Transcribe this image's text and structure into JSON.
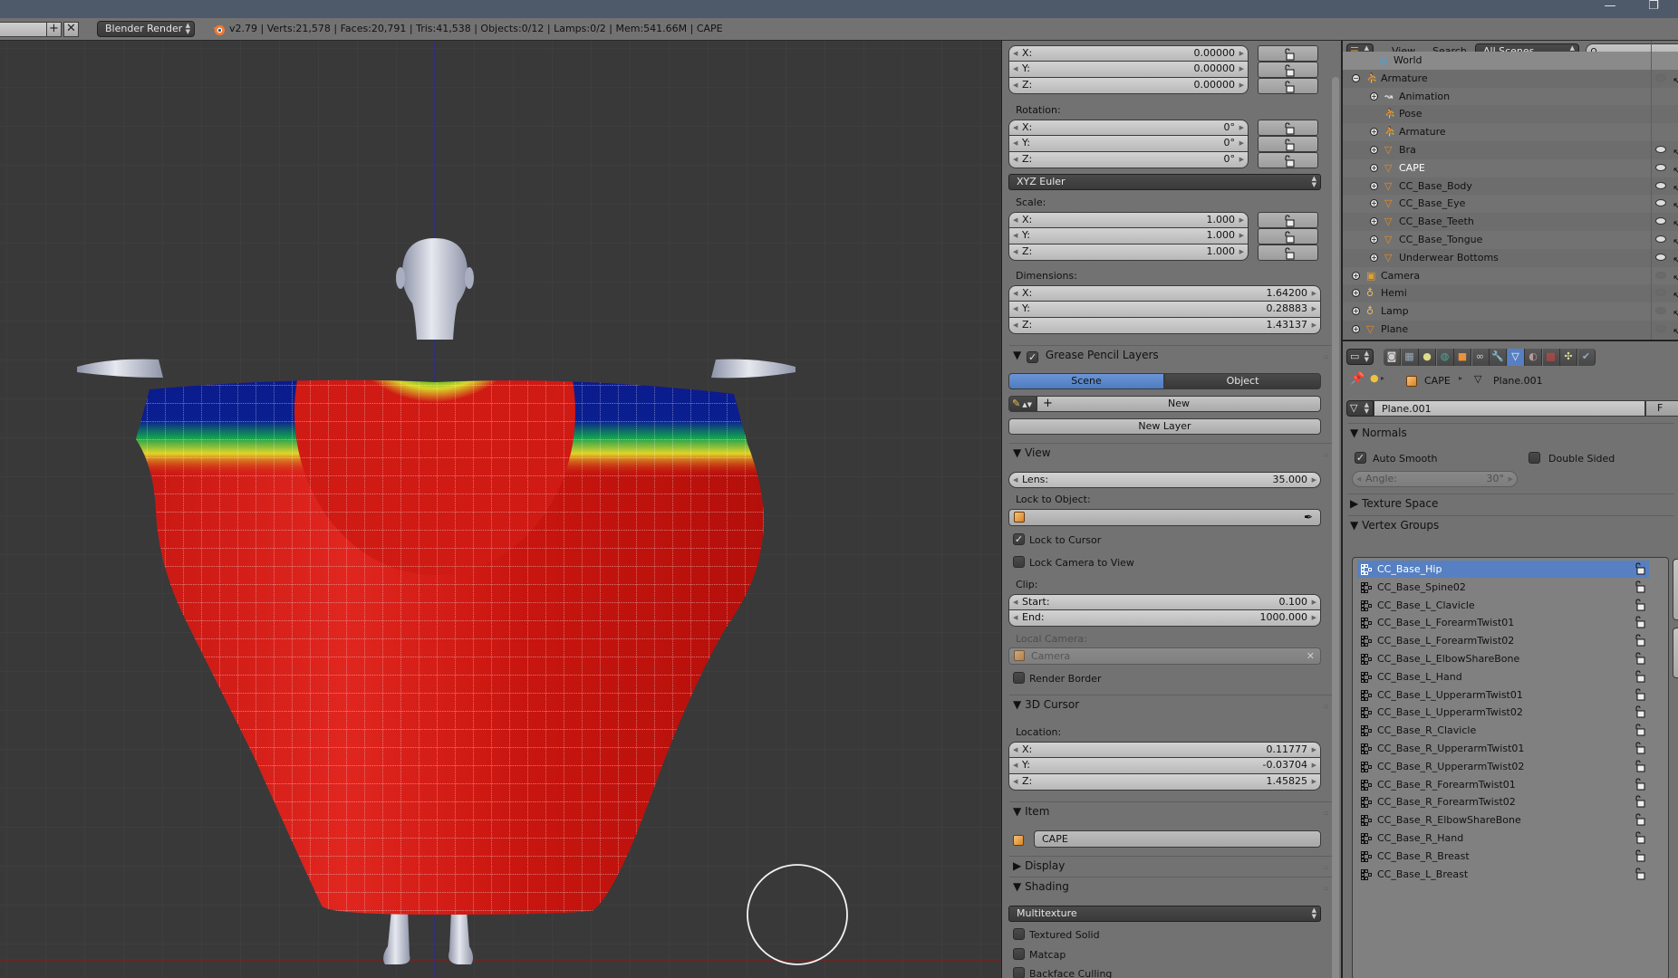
{
  "window": {
    "minimize_icon": "—",
    "restore_icon": "❐"
  },
  "info_bar": {
    "scene_field_value": "",
    "add_icon": "+",
    "remove_icon": "✕",
    "render_engine": "Blender Render",
    "stats": "v2.79 | Verts:21,578 | Faces:20,791 | Tris:41,538 | Objects:0/12 | Lamps:0/2 | Mem:541.66M | CAPE"
  },
  "npanel": {
    "location": {
      "x": {
        "k": "X:",
        "v": "0.00000"
      },
      "y": {
        "k": "Y:",
        "v": "0.00000"
      },
      "z": {
        "k": "Z:",
        "v": "0.00000"
      }
    },
    "rotation_label": "Rotation:",
    "rotation": {
      "x": {
        "k": "X:",
        "v": "0°"
      },
      "y": {
        "k": "Y:",
        "v": "0°"
      },
      "z": {
        "k": "Z:",
        "v": "0°"
      }
    },
    "rotation_mode": "XYZ Euler",
    "scale_label": "Scale:",
    "scale": {
      "x": {
        "k": "X:",
        "v": "1.000"
      },
      "y": {
        "k": "Y:",
        "v": "1.000"
      },
      "z": {
        "k": "Z:",
        "v": "1.000"
      }
    },
    "dimensions_label": "Dimensions:",
    "dimensions": {
      "x": {
        "k": "X:",
        "v": "1.64200"
      },
      "y": {
        "k": "Y:",
        "v": "0.28883"
      },
      "z": {
        "k": "Z:",
        "v": "1.43137"
      }
    },
    "grease_pencil": {
      "title": "Grease Pencil Layers",
      "enabled": true,
      "tab_scene": "Scene",
      "tab_object": "Object",
      "active_tab": "Scene",
      "new_label": "New",
      "new_layer_label": "New Layer"
    },
    "view": {
      "title": "View",
      "lens_label": "Lens:",
      "lens_value": "35.000",
      "lock_to_object_label": "Lock to Object:",
      "lock_to_object_value": "",
      "lock_to_cursor_label": "Lock to Cursor",
      "lock_to_cursor": true,
      "lock_camera_label": "Lock Camera to View",
      "lock_camera": false,
      "clip_label": "Clip:",
      "clip_start_label": "Start:",
      "clip_start": "0.100",
      "clip_end_label": "End:",
      "clip_end": "1000.000",
      "local_camera_label": "Local Camera:",
      "local_camera_value": "Camera",
      "render_border_label": "Render Border",
      "render_border": false
    },
    "cursor": {
      "title": "3D Cursor",
      "location_label": "Location:",
      "x": {
        "k": "X:",
        "v": "0.11777"
      },
      "y": {
        "k": "Y:",
        "v": "-0.03704"
      },
      "z": {
        "k": "Z:",
        "v": "1.45825"
      }
    },
    "item": {
      "title": "Item",
      "name": "CAPE"
    },
    "display": {
      "title": "Display"
    },
    "shading": {
      "title": "Shading",
      "mode": "Multitexture",
      "textured_solid_label": "Textured Solid",
      "matcap_label": "Matcap",
      "backface_label": "Backface Culling"
    }
  },
  "outliner": {
    "view_menu": "View",
    "search_menu": "Search",
    "display_mode": "All Scenes",
    "search_value": "",
    "rows": [
      {
        "name": "World",
        "type": "world",
        "visible": null
      },
      {
        "name": "Armature",
        "type": "armature",
        "visible": false
      },
      {
        "name": "Animation",
        "type": "animation",
        "visible": null
      },
      {
        "name": "Pose",
        "type": "pose",
        "visible": null
      },
      {
        "name": "Armature",
        "type": "armature-data",
        "visible": null
      },
      {
        "name": "Bra",
        "type": "mesh",
        "visible": true
      },
      {
        "name": "CAPE",
        "type": "mesh",
        "visible": true,
        "active": true
      },
      {
        "name": "CC_Base_Body",
        "type": "mesh",
        "visible": true
      },
      {
        "name": "CC_Base_Eye",
        "type": "mesh",
        "visible": true
      },
      {
        "name": "CC_Base_Teeth",
        "type": "mesh",
        "visible": true
      },
      {
        "name": "CC_Base_Tongue",
        "type": "mesh",
        "visible": true
      },
      {
        "name": "Underwear Bottoms",
        "type": "mesh",
        "visible": true
      },
      {
        "name": "Camera",
        "type": "camera",
        "visible": false
      },
      {
        "name": "Hemi",
        "type": "lamp",
        "visible": false
      },
      {
        "name": "Lamp",
        "type": "lamp",
        "visible": false
      },
      {
        "name": "Plane",
        "type": "mesh",
        "visible": false
      }
    ]
  },
  "properties": {
    "tabs": [
      "render-icon",
      "render-layers-icon",
      "scene-icon",
      "world-icon",
      "object-icon",
      "constraints-icon",
      "modifiers-icon",
      "mesh-data-icon",
      "material-icon",
      "texture-icon",
      "particles-icon",
      "physics-icon"
    ],
    "active_tab": "mesh-data-icon",
    "breadcrumb": {
      "object": "CAPE",
      "data": "Plane.001"
    },
    "mesh_name": "Plane.001",
    "fake_user": "F",
    "normals": {
      "title": "Normals",
      "auto_smooth_label": "Auto Smooth",
      "auto_smooth": true,
      "double_sided_label": "Double Sided",
      "double_sided": false,
      "angle_label": "Angle:",
      "angle_value": "30°"
    },
    "texture_space": {
      "title": "Texture Space"
    },
    "vertex_groups": {
      "title": "Vertex Groups",
      "active": "CC_Base_Hip",
      "items": [
        "CC_Base_Hip",
        "CC_Base_Spine02",
        "CC_Base_L_Clavicle",
        "CC_Base_L_ForearmTwist01",
        "CC_Base_L_ForearmTwist02",
        "CC_Base_L_ElbowShareBone",
        "CC_Base_L_Hand",
        "CC_Base_L_UpperarmTwist01",
        "CC_Base_L_UpperarmTwist02",
        "CC_Base_R_Clavicle",
        "CC_Base_R_UpperarmTwist01",
        "CC_Base_R_UpperarmTwist02",
        "CC_Base_R_ForearmTwist01",
        "CC_Base_R_ForearmTwist02",
        "CC_Base_R_ElbowShareBone",
        "CC_Base_R_Hand",
        "CC_Base_R_Breast",
        "CC_Base_L_Breast"
      ]
    }
  },
  "colors": {
    "accent_blue": "#5680c2",
    "viewport_bg": "#393939",
    "panel_bg": "#727272",
    "titlebar": "#4e5a69",
    "heat_red": "#d01a14",
    "heat_blue": "#0a1a8c"
  }
}
